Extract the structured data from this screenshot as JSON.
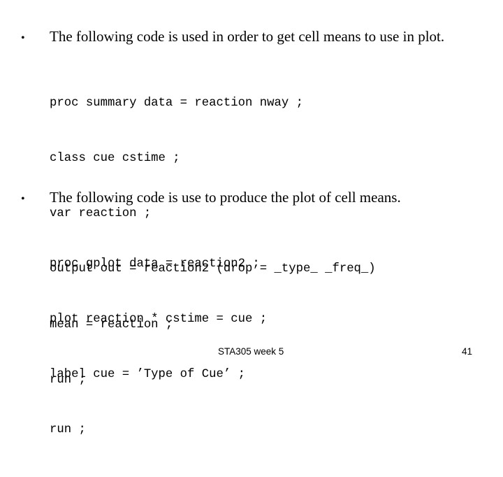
{
  "slide": {
    "sections": [
      {
        "bullet": "•",
        "text": "The following code is used in order to get cell means to use in plot.",
        "code": [
          "proc summary data = reaction nway ;",
          "class cue cstime ;",
          "var reaction ;",
          "output out = reaction2 (drop = _type_ _freq_)",
          "mean = reaction ;",
          "run ;"
        ]
      },
      {
        "bullet": "•",
        "text": "The following code is use to produce the plot of cell means.",
        "code": [
          "proc gplot data = reaction2 ;",
          "plot reaction * cstime = cue ;",
          "label cue = ’Type of Cue’ ;",
          "run ;"
        ]
      }
    ],
    "footer": {
      "center": "STA305 week 5",
      "page_number": "41"
    }
  }
}
